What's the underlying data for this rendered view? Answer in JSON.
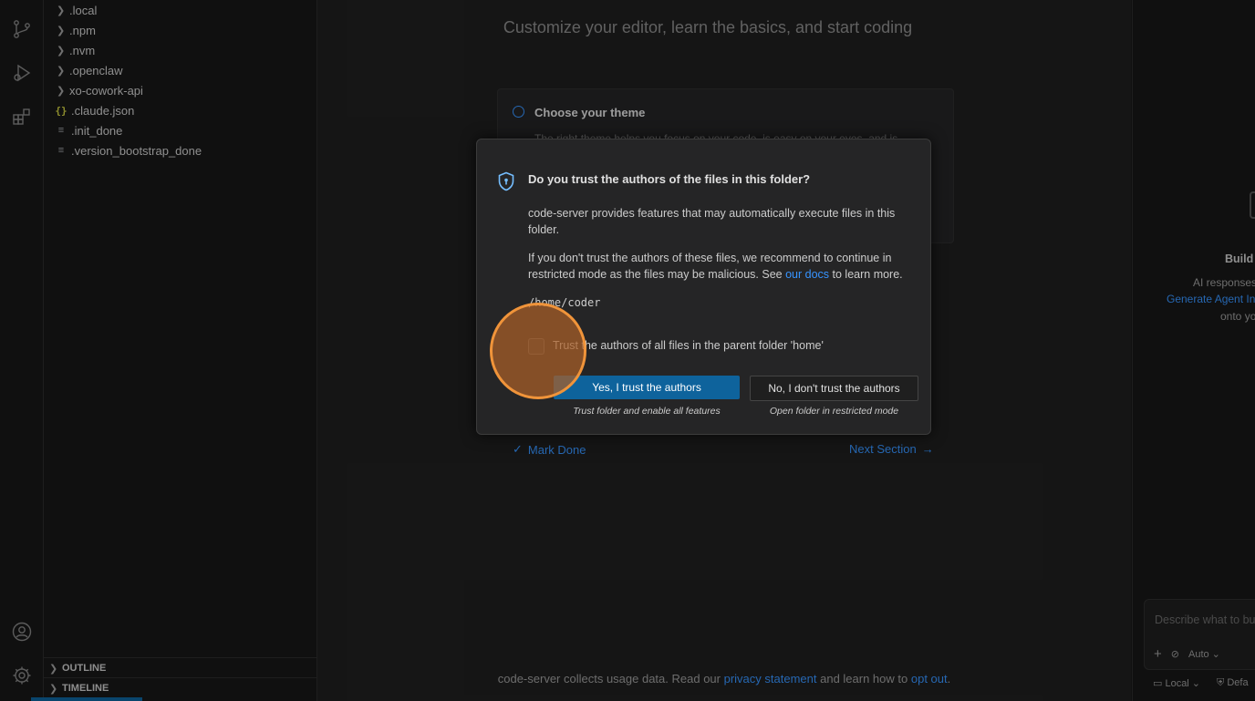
{
  "explorer": {
    "items": [
      {
        "label": ".local",
        "kind": "folder"
      },
      {
        "label": ".npm",
        "kind": "folder"
      },
      {
        "label": ".nvm",
        "kind": "folder"
      },
      {
        "label": ".openclaw",
        "kind": "folder"
      },
      {
        "label": "xo-cowork-api",
        "kind": "folder"
      },
      {
        "label": ".claude.json",
        "kind": "json",
        "icon": "{}"
      },
      {
        "label": ".init_done",
        "kind": "file"
      },
      {
        "label": ".version_bootstrap_done",
        "kind": "file"
      }
    ],
    "outline_label": "OUTLINE",
    "timeline_label": "TIMELINE"
  },
  "walkthrough": {
    "subtitle": "Customize your editor, learn the basics, and start coding",
    "step_title": "Choose your theme",
    "step_desc": "The right theme helps you focus on your code, is easy on your eyes, and is",
    "mark_done": "Mark Done",
    "next_section": "Next Section",
    "footer": {
      "prefix": "code-server collects usage data. Read our",
      "privacy_link": "privacy statement",
      "middle": "and learn how to",
      "opt_out_link": "opt out",
      "suffix": "."
    }
  },
  "dialog": {
    "title": "Do you trust the authors of the files in this folder?",
    "p1": "code-server provides features that may automatically execute files in this folder.",
    "p2_prefix": "If you don't trust the authors of these files, we recommend to continue in restricted mode as the files may be malicious. See",
    "p2_link": "our docs",
    "p2_suffix": "to learn more.",
    "path": "/home/coder",
    "checkbox_label": "Trust the authors of all files in the parent folder 'home'",
    "checkbox_checked": false,
    "yes_button": "Yes, I trust the authors",
    "yes_sub": "Trust folder and enable all features",
    "no_button": "No, I don't trust the authors",
    "no_sub": "Open folder in restricted mode"
  },
  "chat": {
    "title": "Build",
    "line1": "AI responses",
    "line2": "Generate Agent In",
    "line3": "onto yo",
    "input_placeholder": "Describe what to bu",
    "mode": "Auto",
    "location": "Local",
    "default_label": "Defa"
  },
  "colors": {
    "accent": "#0e639c",
    "link": "#3794ff",
    "cursor_ring": "#f0943a"
  }
}
